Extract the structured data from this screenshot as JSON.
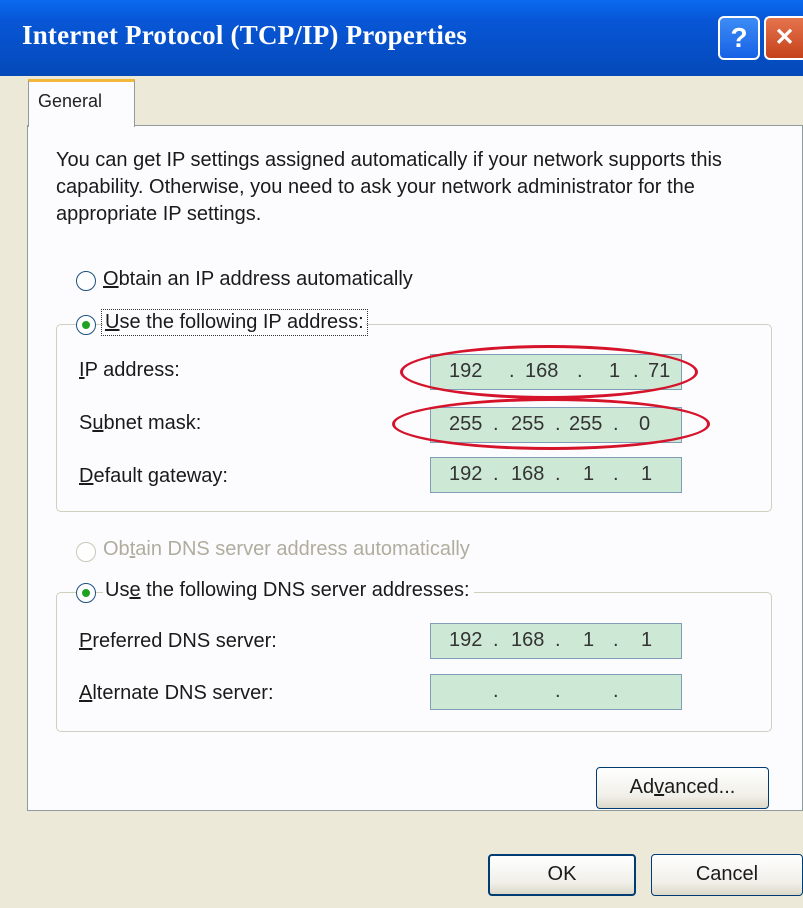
{
  "window": {
    "title": "Internet Protocol (TCP/IP) Properties",
    "help_glyph": "?",
    "close_glyph": "✕"
  },
  "tabs": [
    {
      "label": "General",
      "active": true
    }
  ],
  "intro_text": "You can get IP settings assigned automatically if your network supports this capability. Otherwise, you need to ask your network administrator for the appropriate IP settings.",
  "ip_mode": {
    "auto": {
      "label_pre": "",
      "label_key": "O",
      "label_post": "btain an IP address automatically",
      "selected": false
    },
    "manual": {
      "label_pre": "",
      "label_key": "U",
      "label_post": "se the following IP address:",
      "selected": true
    }
  },
  "ip_fields": [
    {
      "label_pre": "",
      "label_key": "I",
      "label_post": "P address:",
      "octets": [
        "192",
        "168",
        "1",
        "71"
      ]
    },
    {
      "label_pre": "S",
      "label_key": "u",
      "label_post": "bnet mask:",
      "octets": [
        "255",
        "255",
        "255",
        "0"
      ]
    },
    {
      "label_pre": "",
      "label_key": "D",
      "label_post": "efault gateway:",
      "octets": [
        "192",
        "168",
        "1",
        "1"
      ]
    }
  ],
  "dns_mode": {
    "auto": {
      "label_pre": "Ob",
      "label_key": "t",
      "label_post": "ain DNS server address automatically",
      "selected": false,
      "disabled": true
    },
    "manual": {
      "label_pre": "Us",
      "label_key": "e",
      "label_post": " the following DNS server addresses:",
      "selected": true
    }
  },
  "dns_fields": [
    {
      "label_pre": "",
      "label_key": "P",
      "label_post": "referred DNS server:",
      "octets": [
        "192",
        "168",
        "1",
        "1"
      ]
    },
    {
      "label_pre": "",
      "label_key": "A",
      "label_post": "lternate DNS server:",
      "octets": [
        "",
        "",
        "",
        ""
      ]
    }
  ],
  "separator": ".",
  "buttons": {
    "advanced": {
      "label_pre": "Ad",
      "label_key": "v",
      "label_post": "anced..."
    },
    "ok": "OK",
    "cancel": "Cancel"
  },
  "colors": {
    "title_bar": "#0650c9",
    "field_fill": "#cde9d6",
    "highlight_ring": "#d5132b",
    "dialog_bg": "#ece9d8"
  }
}
